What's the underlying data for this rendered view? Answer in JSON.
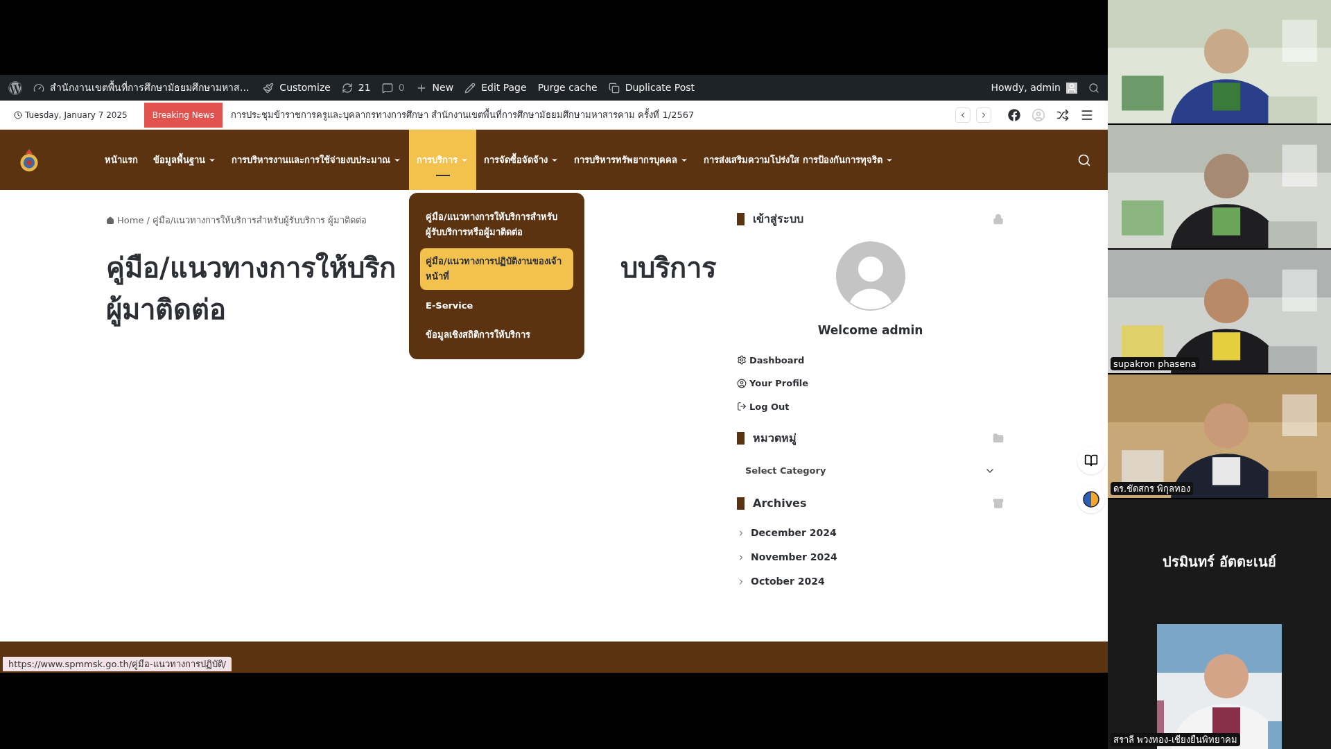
{
  "admin_bar": {
    "site_title": "สำนักงานเขตพื้นที่การศึกษามัธยมศึกษามหาส...",
    "items": [
      {
        "kind": "customize",
        "label": "Customize"
      },
      {
        "kind": "updates",
        "label": "21"
      },
      {
        "kind": "comments",
        "label": "0"
      },
      {
        "kind": "new",
        "label": "New"
      },
      {
        "kind": "edit",
        "label": "Edit Page"
      },
      {
        "kind": "plain",
        "label": "Purge cache"
      },
      {
        "kind": "duplicate",
        "label": "Duplicate Post"
      }
    ],
    "greeting": "Howdy, admin"
  },
  "top_bar": {
    "date": "Tuesday, January 7 2025",
    "breaking_label": "Breaking News",
    "headline": "การประชุมข้าราชการครูและบุคลากรทางการศึกษา สำนักงานเขตพื้นที่การศึกษามัธยมศึกษามหาสารคาม ครั้งที่ 1/2567"
  },
  "nav": {
    "items": [
      {
        "label": "หน้าแรก",
        "has_submenu": false,
        "selected": false
      },
      {
        "label": "ข้อมูลพื้นฐาน",
        "has_submenu": true,
        "selected": false
      },
      {
        "label": "การบริหารงานและการใช้จ่ายงบประมาณ",
        "has_submenu": true,
        "selected": false
      },
      {
        "label": "การบริการ",
        "has_submenu": true,
        "selected": true
      },
      {
        "label": "การจัดซื้อจัดจ้าง",
        "has_submenu": true,
        "selected": false
      },
      {
        "label": "การบริหารทรัพยากรบุคคล",
        "has_submenu": true,
        "selected": false
      },
      {
        "label": "การส่งเสริมความโปร่งใส การป้องกันการทุจริต",
        "has_submenu": true,
        "selected": false
      }
    ],
    "submenu": [
      {
        "label": "คู่มือ/แนวทางการให้บริการสำหรับผู้รับบริการหรือผู้มาติดต่อ",
        "selected": false
      },
      {
        "label": "คู่มือ/แนวทางการปฏิบัติงานของเจ้าหน้าที่",
        "selected": true
      },
      {
        "label": "E-Service",
        "selected": false
      },
      {
        "label": "ข้อมูลเชิงสถิติการให้บริการ",
        "selected": false
      }
    ]
  },
  "breadcrumb": {
    "home": "Home",
    "separator": "/",
    "current": "คู่มือ/แนวทางการให้บริการสำหรับผู้รับบริการ ผู้มาติดต่อ"
  },
  "title_parts": [
    "คู่มือ/แนวทางการให้บริก",
    "บบริการ",
    "ผู้มาติดต่อ"
  ],
  "sidebar": {
    "login": {
      "heading": "เข้าสู่ระบบ",
      "welcome": "Welcome admin",
      "links": [
        {
          "kind": "dashboard",
          "label": "Dashboard"
        },
        {
          "kind": "profile",
          "label": "Your Profile"
        },
        {
          "kind": "logout",
          "label": "Log Out"
        }
      ]
    },
    "categories": {
      "heading": "หมวดหมู่",
      "select": "Select Category"
    },
    "archives": {
      "heading": "Archives",
      "items": [
        "December 2024",
        "November 2024",
        "October 2024"
      ]
    }
  },
  "status_url": "https://www.spmmsk.go.th/คู่มือ-แนวทางการปฏิบัติ/",
  "participants": [
    {
      "kind": "video"
    },
    {
      "kind": "video"
    },
    {
      "kind": "video",
      "name": "supakron phasena"
    },
    {
      "kind": "video",
      "name": "ดร.ชัดสกร พิกุลทอง"
    },
    {
      "kind": "name_only",
      "name": "ปรมินทร์ อัตตะเนย์"
    },
    {
      "name": "สราลี พวงทอง-เชียงยืนพิทยาคม"
    }
  ]
}
